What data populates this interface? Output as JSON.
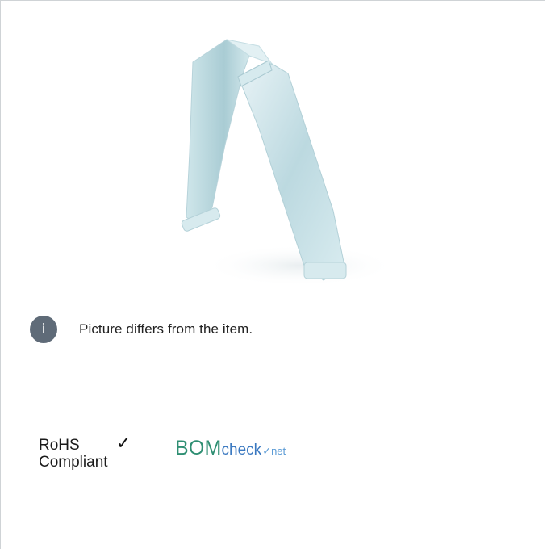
{
  "info": {
    "icon_label": "i",
    "note": "Picture differs from the item."
  },
  "compliance": {
    "rohs_line1": "RoHS",
    "rohs_check": "✓",
    "rohs_line2": "Compliant",
    "bom_part1": "BOM",
    "bom_part2": "check",
    "bom_part3": "✓net"
  },
  "colors": {
    "info_icon_bg": "#5f6b78",
    "bom_green": "#2f8f73",
    "bom_blue": "#3a78c0"
  }
}
